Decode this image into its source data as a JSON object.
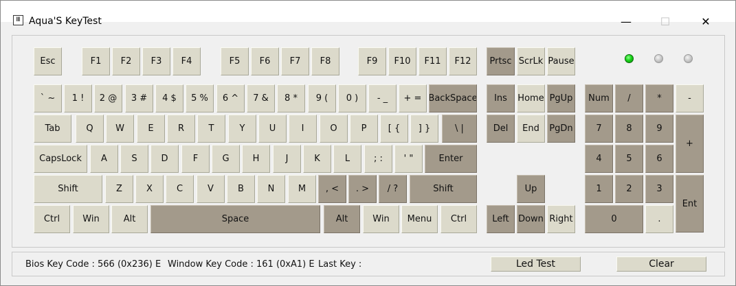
{
  "window": {
    "title": "Aqua'S KeyTest",
    "icon_glyph": "Ⅲ",
    "controls": {
      "minimize": "—",
      "maximize": "☐",
      "close": "✕"
    }
  },
  "keys": {
    "esc": "Esc",
    "f1": "F1",
    "f2": "F2",
    "f3": "F3",
    "f4": "F4",
    "f5": "F5",
    "f6": "F6",
    "f7": "F7",
    "f8": "F8",
    "f9": "F9",
    "f10": "F10",
    "f11": "F11",
    "f12": "F12",
    "prtsc": "Prtsc",
    "scrlk": "ScrLk",
    "pause": "Pause",
    "backtick": "` ~",
    "n1": "1 !",
    "n2": "2 @",
    "n3": "3 #",
    "n4": "4 $",
    "n5": "5 %",
    "n6": "6 ^",
    "n7": "7 &",
    "n8": "8 *",
    "n9": "9 (",
    "n0": "0 )",
    "minus": "- _",
    "equals": "+ =",
    "backspace": "BackSpace",
    "ins": "Ins",
    "home": "Home",
    "pgup": "PgUp",
    "num": "Num",
    "np_div": "/",
    "np_mul": "*",
    "np_sub": "-",
    "tab": "Tab",
    "q": "Q",
    "w": "W",
    "e": "E",
    "r": "R",
    "t": "T",
    "y": "Y",
    "u": "U",
    "i": "I",
    "o": "O",
    "p": "P",
    "lbracket": "[ {",
    "rbracket": "] }",
    "backslash": "\\ |",
    "del": "Del",
    "end": "End",
    "pgdn": "PgDn",
    "np7": "7",
    "np8": "8",
    "np9": "9",
    "np_add": "+",
    "capslock": "CapsLock",
    "a": "A",
    "s": "S",
    "d": "D",
    "f": "F",
    "g": "G",
    "h": "H",
    "j": "J",
    "k": "K",
    "l": "L",
    "semicolon": "; :",
    "quote": "' \"",
    "enter": "Enter",
    "np4": "4",
    "np5": "5",
    "np6": "6",
    "lshift": "Shift",
    "z": "Z",
    "x": "X",
    "c": "C",
    "v": "V",
    "b": "B",
    "n": "N",
    "m": "M",
    "comma": ", <",
    "period": ". >",
    "slash": "/ ?",
    "rshift": "Shift",
    "up": "Up",
    "np1": "1",
    "np2": "2",
    "np3": "3",
    "np_enter": "Ent",
    "lctrl": "Ctrl",
    "lwin": "Win",
    "lalt": "Alt",
    "space": "Space",
    "ralt": "Alt",
    "rwin": "Win",
    "menu": "Menu",
    "rctrl": "Ctrl",
    "left": "Left",
    "down": "Down",
    "right": "Right",
    "np0": "0",
    "np_dot": "."
  },
  "leds": [
    {
      "name": "num-lock",
      "state": "on"
    },
    {
      "name": "caps-lock",
      "state": "off"
    },
    {
      "name": "scroll-lock",
      "state": "off"
    }
  ],
  "status": {
    "bios_key_code": "Bios Key Code : 566 (0x236) E",
    "window_key_code": "Window Key Code : 161 (0xA1) E",
    "last_key": "Last Key :",
    "led_test_label": "Led Test",
    "clear_label": "Clear"
  },
  "colors": {
    "key_light": "#dcdacb",
    "key_dark": "#a39a8b",
    "led_on": "#19d419"
  }
}
